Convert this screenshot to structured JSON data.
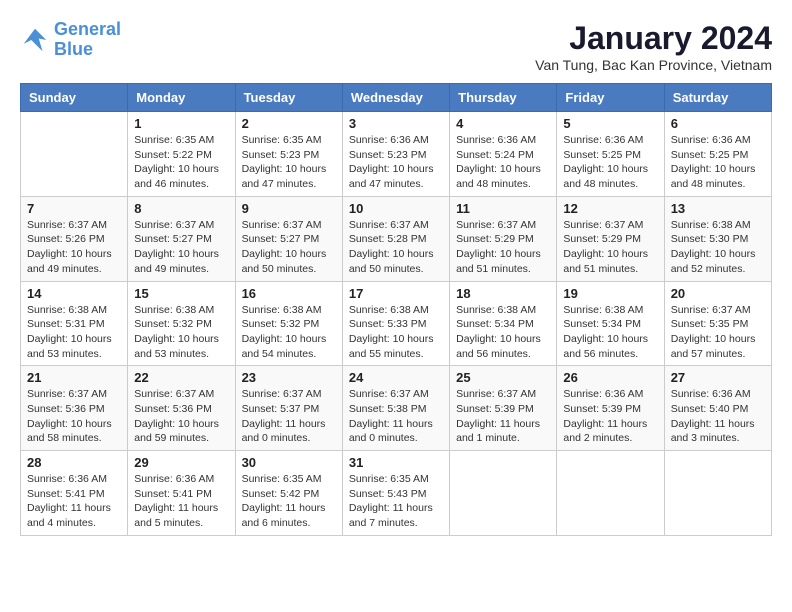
{
  "logo": {
    "line1": "General",
    "line2": "Blue"
  },
  "title": "January 2024",
  "location": "Van Tung, Bac Kan Province, Vietnam",
  "days_of_week": [
    "Sunday",
    "Monday",
    "Tuesday",
    "Wednesday",
    "Thursday",
    "Friday",
    "Saturday"
  ],
  "weeks": [
    [
      {
        "day": null,
        "sunrise": null,
        "sunset": null,
        "daylight": null
      },
      {
        "day": "1",
        "sunrise": "Sunrise: 6:35 AM",
        "sunset": "Sunset: 5:22 PM",
        "daylight": "Daylight: 10 hours and 46 minutes."
      },
      {
        "day": "2",
        "sunrise": "Sunrise: 6:35 AM",
        "sunset": "Sunset: 5:23 PM",
        "daylight": "Daylight: 10 hours and 47 minutes."
      },
      {
        "day": "3",
        "sunrise": "Sunrise: 6:36 AM",
        "sunset": "Sunset: 5:23 PM",
        "daylight": "Daylight: 10 hours and 47 minutes."
      },
      {
        "day": "4",
        "sunrise": "Sunrise: 6:36 AM",
        "sunset": "Sunset: 5:24 PM",
        "daylight": "Daylight: 10 hours and 48 minutes."
      },
      {
        "day": "5",
        "sunrise": "Sunrise: 6:36 AM",
        "sunset": "Sunset: 5:25 PM",
        "daylight": "Daylight: 10 hours and 48 minutes."
      },
      {
        "day": "6",
        "sunrise": "Sunrise: 6:36 AM",
        "sunset": "Sunset: 5:25 PM",
        "daylight": "Daylight: 10 hours and 48 minutes."
      }
    ],
    [
      {
        "day": "7",
        "sunrise": "Sunrise: 6:37 AM",
        "sunset": "Sunset: 5:26 PM",
        "daylight": "Daylight: 10 hours and 49 minutes."
      },
      {
        "day": "8",
        "sunrise": "Sunrise: 6:37 AM",
        "sunset": "Sunset: 5:27 PM",
        "daylight": "Daylight: 10 hours and 49 minutes."
      },
      {
        "day": "9",
        "sunrise": "Sunrise: 6:37 AM",
        "sunset": "Sunset: 5:27 PM",
        "daylight": "Daylight: 10 hours and 50 minutes."
      },
      {
        "day": "10",
        "sunrise": "Sunrise: 6:37 AM",
        "sunset": "Sunset: 5:28 PM",
        "daylight": "Daylight: 10 hours and 50 minutes."
      },
      {
        "day": "11",
        "sunrise": "Sunrise: 6:37 AM",
        "sunset": "Sunset: 5:29 PM",
        "daylight": "Daylight: 10 hours and 51 minutes."
      },
      {
        "day": "12",
        "sunrise": "Sunrise: 6:37 AM",
        "sunset": "Sunset: 5:29 PM",
        "daylight": "Daylight: 10 hours and 51 minutes."
      },
      {
        "day": "13",
        "sunrise": "Sunrise: 6:38 AM",
        "sunset": "Sunset: 5:30 PM",
        "daylight": "Daylight: 10 hours and 52 minutes."
      }
    ],
    [
      {
        "day": "14",
        "sunrise": "Sunrise: 6:38 AM",
        "sunset": "Sunset: 5:31 PM",
        "daylight": "Daylight: 10 hours and 53 minutes."
      },
      {
        "day": "15",
        "sunrise": "Sunrise: 6:38 AM",
        "sunset": "Sunset: 5:32 PM",
        "daylight": "Daylight: 10 hours and 53 minutes."
      },
      {
        "day": "16",
        "sunrise": "Sunrise: 6:38 AM",
        "sunset": "Sunset: 5:32 PM",
        "daylight": "Daylight: 10 hours and 54 minutes."
      },
      {
        "day": "17",
        "sunrise": "Sunrise: 6:38 AM",
        "sunset": "Sunset: 5:33 PM",
        "daylight": "Daylight: 10 hours and 55 minutes."
      },
      {
        "day": "18",
        "sunrise": "Sunrise: 6:38 AM",
        "sunset": "Sunset: 5:34 PM",
        "daylight": "Daylight: 10 hours and 56 minutes."
      },
      {
        "day": "19",
        "sunrise": "Sunrise: 6:38 AM",
        "sunset": "Sunset: 5:34 PM",
        "daylight": "Daylight: 10 hours and 56 minutes."
      },
      {
        "day": "20",
        "sunrise": "Sunrise: 6:37 AM",
        "sunset": "Sunset: 5:35 PM",
        "daylight": "Daylight: 10 hours and 57 minutes."
      }
    ],
    [
      {
        "day": "21",
        "sunrise": "Sunrise: 6:37 AM",
        "sunset": "Sunset: 5:36 PM",
        "daylight": "Daylight: 10 hours and 58 minutes."
      },
      {
        "day": "22",
        "sunrise": "Sunrise: 6:37 AM",
        "sunset": "Sunset: 5:36 PM",
        "daylight": "Daylight: 10 hours and 59 minutes."
      },
      {
        "day": "23",
        "sunrise": "Sunrise: 6:37 AM",
        "sunset": "Sunset: 5:37 PM",
        "daylight": "Daylight: 11 hours and 0 minutes."
      },
      {
        "day": "24",
        "sunrise": "Sunrise: 6:37 AM",
        "sunset": "Sunset: 5:38 PM",
        "daylight": "Daylight: 11 hours and 0 minutes."
      },
      {
        "day": "25",
        "sunrise": "Sunrise: 6:37 AM",
        "sunset": "Sunset: 5:39 PM",
        "daylight": "Daylight: 11 hours and 1 minute."
      },
      {
        "day": "26",
        "sunrise": "Sunrise: 6:36 AM",
        "sunset": "Sunset: 5:39 PM",
        "daylight": "Daylight: 11 hours and 2 minutes."
      },
      {
        "day": "27",
        "sunrise": "Sunrise: 6:36 AM",
        "sunset": "Sunset: 5:40 PM",
        "daylight": "Daylight: 11 hours and 3 minutes."
      }
    ],
    [
      {
        "day": "28",
        "sunrise": "Sunrise: 6:36 AM",
        "sunset": "Sunset: 5:41 PM",
        "daylight": "Daylight: 11 hours and 4 minutes."
      },
      {
        "day": "29",
        "sunrise": "Sunrise: 6:36 AM",
        "sunset": "Sunset: 5:41 PM",
        "daylight": "Daylight: 11 hours and 5 minutes."
      },
      {
        "day": "30",
        "sunrise": "Sunrise: 6:35 AM",
        "sunset": "Sunset: 5:42 PM",
        "daylight": "Daylight: 11 hours and 6 minutes."
      },
      {
        "day": "31",
        "sunrise": "Sunrise: 6:35 AM",
        "sunset": "Sunset: 5:43 PM",
        "daylight": "Daylight: 11 hours and 7 minutes."
      },
      {
        "day": null,
        "sunrise": null,
        "sunset": null,
        "daylight": null
      },
      {
        "day": null,
        "sunrise": null,
        "sunset": null,
        "daylight": null
      },
      {
        "day": null,
        "sunrise": null,
        "sunset": null,
        "daylight": null
      }
    ]
  ]
}
